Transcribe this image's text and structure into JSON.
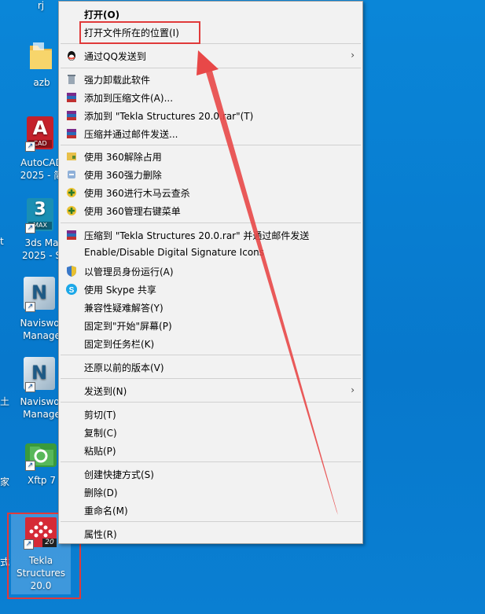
{
  "desktop": {
    "top_label": "rj",
    "icons": [
      {
        "label1": "azb",
        "label2": ""
      },
      {
        "label1": "AutoCAD",
        "label2": "2025 - 简",
        "badge": "CAD"
      },
      {
        "label1": "3ds Ma",
        "label2": "2025 - S",
        "badge": "MAX"
      },
      {
        "label1": "Naviswor",
        "label2": "Manage"
      },
      {
        "label1": "Naviswor",
        "label2": "Manage"
      },
      {
        "label1": "Xftp 7",
        "label2": ""
      },
      {
        "label1": "Tekla",
        "label2": "Structures",
        "label3": "20.0",
        "badge": "20"
      }
    ],
    "left_edge_labels": [
      "t",
      "土",
      "家",
      "式"
    ]
  },
  "menu": {
    "open": "打开(O)",
    "open_location": "打开文件所在的位置(I)",
    "qq_send": "通过QQ发送到",
    "uninstall": "强力卸载此软件",
    "add_archive": "添加到压缩文件(A)...",
    "add_to_rar": "添加到 \"Tekla Structures 20.0.rar\"(T)",
    "compress_email": "压缩并通过邮件发送...",
    "unlock_360": "使用 360解除占用",
    "force_delete_360": "使用 360强力删除",
    "trojan_scan_360": "使用 360进行木马云查杀",
    "manage_menu_360": "使用 360管理右键菜单",
    "compress_rar_email": "压缩到 \"Tekla Structures 20.0.rar\" 并通过邮件发送",
    "digital_signature": "Enable/Disable Digital Signature Icons",
    "run_admin": "以管理员身份运行(A)",
    "skype_share": "使用 Skype 共享",
    "troubleshoot": "兼容性疑难解答(Y)",
    "pin_start": "固定到\"开始\"屏幕(P)",
    "pin_taskbar": "固定到任务栏(K)",
    "restore_versions": "还原以前的版本(V)",
    "send_to": "发送到(N)",
    "cut": "剪切(T)",
    "copy": "复制(C)",
    "paste": "粘贴(P)",
    "create_shortcut": "创建快捷方式(S)",
    "delete": "删除(D)",
    "rename": "重命名(M)",
    "properties": "属性(R)"
  },
  "colors": {
    "highlight": "#e03a3a",
    "menu_bg": "#f2f2f2",
    "desktop_bg": "#0a86d8"
  }
}
